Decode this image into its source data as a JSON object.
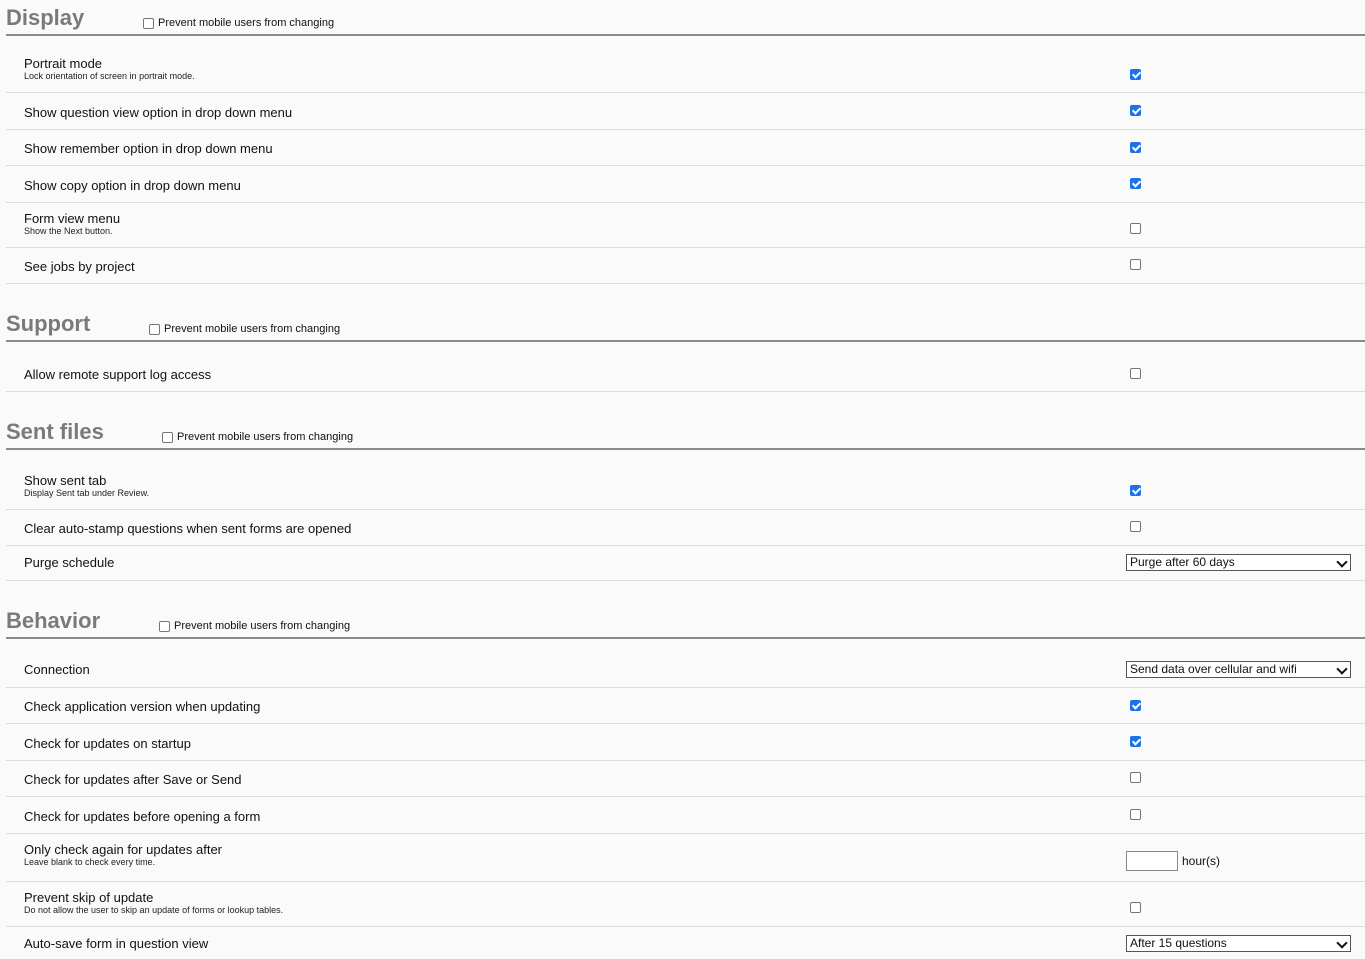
{
  "prevent_label": "Prevent mobile users from changing",
  "display": {
    "title": "Display",
    "rows": [
      {
        "label": "Portrait mode",
        "desc": "Lock orientation of screen in portrait mode.",
        "checked": true
      },
      {
        "label": "Show question view option in drop down menu",
        "checked": true
      },
      {
        "label": "Show remember option in drop down menu",
        "checked": true
      },
      {
        "label": "Show copy option in drop down menu",
        "checked": true
      },
      {
        "label": "Form view menu",
        "desc": "Show the Next button.",
        "checked": false
      },
      {
        "label": "See jobs by project",
        "checked": false
      }
    ]
  },
  "support": {
    "title": "Support",
    "rows": [
      {
        "label": "Allow remote support log access",
        "checked": false
      }
    ]
  },
  "sent_files": {
    "title": "Sent files",
    "rows": [
      {
        "label": "Show sent tab",
        "desc": "Display Sent tab under Review.",
        "checked": true
      },
      {
        "label": "Clear auto-stamp questions when sent forms are opened",
        "checked": false
      },
      {
        "label": "Purge schedule",
        "value": "Purge after 60 days"
      }
    ]
  },
  "behavior": {
    "title": "Behavior",
    "rows": [
      {
        "label": "Connection",
        "value": "Send data over cellular and wifi"
      },
      {
        "label": "Check application version when updating",
        "checked": true
      },
      {
        "label": "Check for updates on startup",
        "checked": true
      },
      {
        "label": "Check for updates after Save or Send",
        "checked": false
      },
      {
        "label": "Check for updates before opening a form",
        "checked": false
      },
      {
        "label": "Only check again for updates after",
        "desc": "Leave blank to check every time.",
        "input_value": "",
        "unit": "hour(s)"
      },
      {
        "label": "Prevent skip of update",
        "desc": "Do not allow the user to skip an update of forms or lookup tables.",
        "checked": false
      },
      {
        "label": "Auto-save form in question view",
        "value": "After 15 questions"
      }
    ]
  }
}
